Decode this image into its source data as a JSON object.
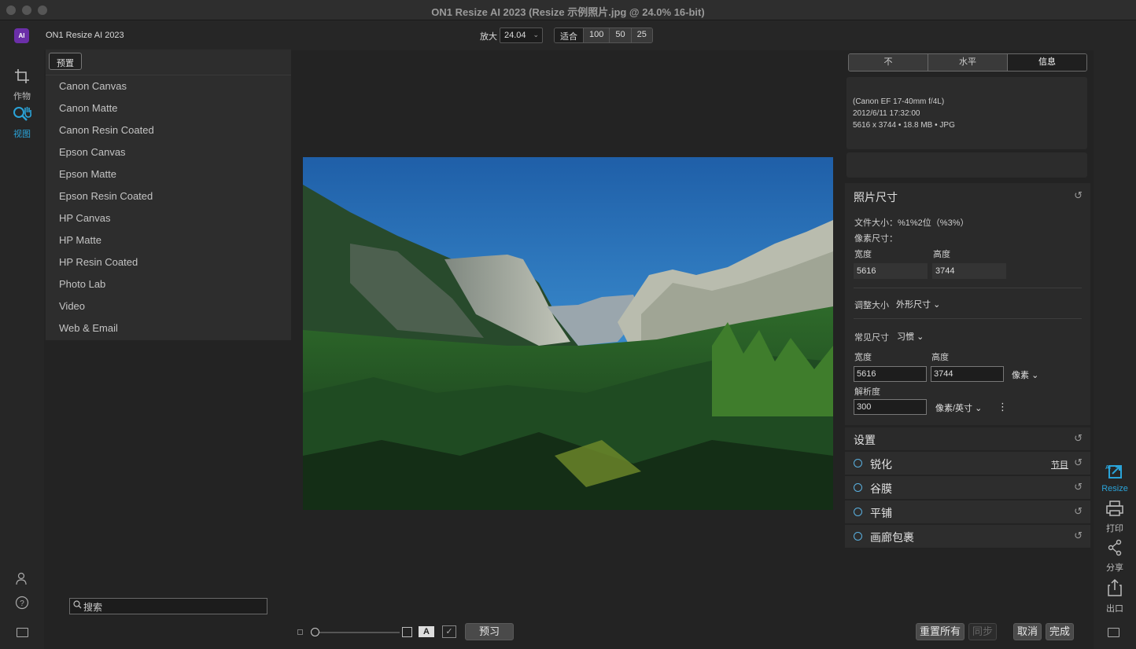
{
  "window": {
    "title": "ON1 Resize AI 2023 (Resize 示例照片.jpg @ 24.0% 16-bit)"
  },
  "app": {
    "name": "ON1 Resize AI 2023",
    "logo_text": "AI"
  },
  "zoom": {
    "label": "放大",
    "value": "24.04",
    "buttons": [
      "适合",
      "100",
      "50",
      "25"
    ]
  },
  "left_tools": [
    {
      "label": "作物",
      "icon": "crop-icon"
    },
    {
      "label": "视图",
      "icon": "zoom-hand-icon",
      "active": true
    }
  ],
  "presets": {
    "button_label": "预置",
    "items": [
      "Canon Canvas",
      "Canon Matte",
      "Canon Resin Coated",
      "Epson Canvas",
      "Epson Matte",
      "Epson Resin Coated",
      "HP Canvas",
      "HP Matte",
      "HP Resin Coated",
      "Photo Lab",
      "Video",
      "Web & Email"
    ]
  },
  "search": {
    "placeholder": "搜索"
  },
  "info_tabs": {
    "tabs": [
      "不",
      "水平",
      "信息"
    ],
    "active": 2
  },
  "info": {
    "lens": "(Canon EF 17-40mm f/4L)",
    "datetime": "2012/6/11  17:32:00",
    "details": "5616 x 3744 • 18.8 MB • JPG"
  },
  "photo_size": {
    "title": "照片尺寸",
    "file_size": "文件大小：%1%2位（%3%）",
    "pixel_size_label": "像素尺寸：",
    "width_label": "宽度",
    "height_label": "高度",
    "width_value": "5616",
    "height_value": "3744",
    "resize_label": "调整大小",
    "resize_mode": "外形尺寸",
    "common_size_label": "常见尺寸",
    "common_size_value": "习惯",
    "width_input": "5616",
    "height_input": "3744",
    "unit": "像素",
    "resolution_label": "解析度",
    "resolution_value": "300",
    "resolution_unit": "像素/英寸"
  },
  "settings": {
    "title": "设置",
    "rows": [
      {
        "label": "锐化",
        "link": "节目"
      },
      {
        "label": "谷膜",
        "link": ""
      },
      {
        "label": "平铺",
        "link": ""
      },
      {
        "label": "画廊包裹",
        "link": ""
      }
    ]
  },
  "right_modules": [
    {
      "label": "Resize",
      "icon": "resize-ai-icon",
      "active": true
    },
    {
      "label": "打印",
      "icon": "printer-icon"
    },
    {
      "label": "分享",
      "icon": "share-icon"
    },
    {
      "label": "出口",
      "icon": "export-icon"
    }
  ],
  "bottom": {
    "preview_label": "预习",
    "text_toggle": "A",
    "reset_all": "重置所有",
    "sync": "同步",
    "cancel": "取消",
    "done": "完成"
  }
}
